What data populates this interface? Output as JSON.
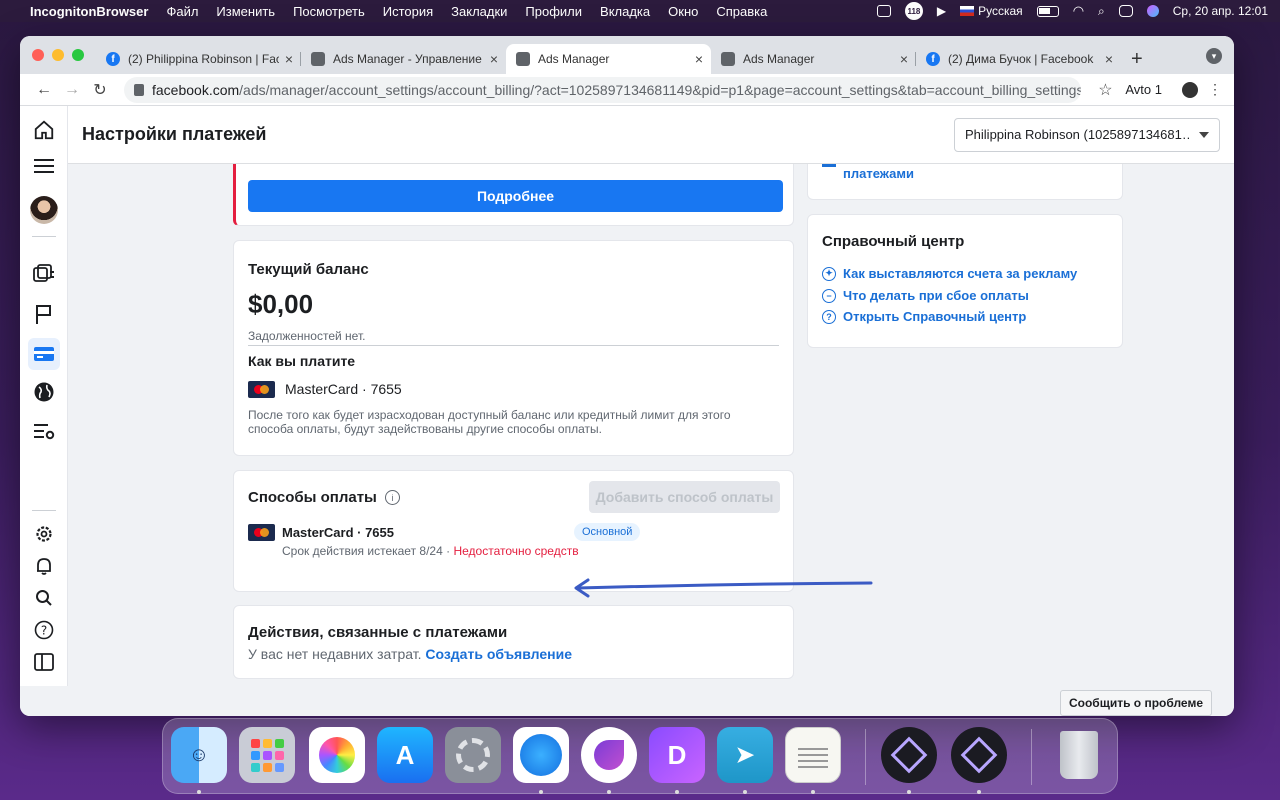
{
  "menubar": {
    "app_name": "IncognitonBrowser",
    "items": [
      "Файл",
      "Изменить",
      "Посмотреть",
      "История",
      "Закладки",
      "Профили",
      "Вкладка",
      "Окно",
      "Справка"
    ],
    "badge": "118",
    "language": "Русская",
    "datetime": "Ср, 20 апр.  12:01"
  },
  "browser": {
    "tabs": [
      {
        "title": "(2) Philippina Robinson | Face",
        "favicon": "facebook-icon"
      },
      {
        "title": "Ads Manager - Управление р",
        "favicon": "page-icon"
      },
      {
        "title": "Ads Manager",
        "favicon": "page-icon"
      },
      {
        "title": "Ads Manager",
        "favicon": "page-icon"
      },
      {
        "title": "(2) Дима Бучок | Facebook",
        "favicon": "facebook-icon"
      }
    ],
    "url_domain": "facebook.com",
    "url_path": "/ads/manager/account_settings/account_billing/?act=1025897134681149&pid=p1&page=account_settings&tab=account_billing_settings",
    "profile_label": "Avto 1"
  },
  "page": {
    "title": "Настройки платежей",
    "account_selector": "Philippina Robinson (1025897134681…",
    "more_button": "Подробнее",
    "balance": {
      "heading": "Текущий баланс",
      "amount": "$0,00",
      "debt_note": "Задолженностей нет.",
      "how_you_pay": "Как вы платите",
      "card": "MasterCard · 7655",
      "note": "После того как будет израсходован доступный баланс или кредитный лимит для этого способа оплаты, будут задействованы другие способы оплаты."
    },
    "payment_methods": {
      "heading": "Способы оплаты",
      "add_button": "Добавить способ оплаты",
      "card": "MasterCard · 7655",
      "badge": "Основной",
      "expiry": "Срок действия истекает 8/24 ·",
      "warning": "Недостаточно средств"
    },
    "actions": {
      "heading": "Действия, связанные с платежами",
      "text": "У вас нет недавних затрат.",
      "link": "Создать объявление"
    },
    "right_top_link": "платежами",
    "help_center": {
      "heading": "Справочный центр",
      "links": [
        "Как выставляются счета за рекламу",
        "Что делать при сбое оплаты",
        "Открыть Справочный центр"
      ]
    },
    "report_button": "Сообщить о проблеме"
  },
  "colors": {
    "primary": "#1877f2",
    "warning": "#e41e3f",
    "link": "#1a6fd6",
    "annotation_arrow": "#3b5bc4"
  }
}
